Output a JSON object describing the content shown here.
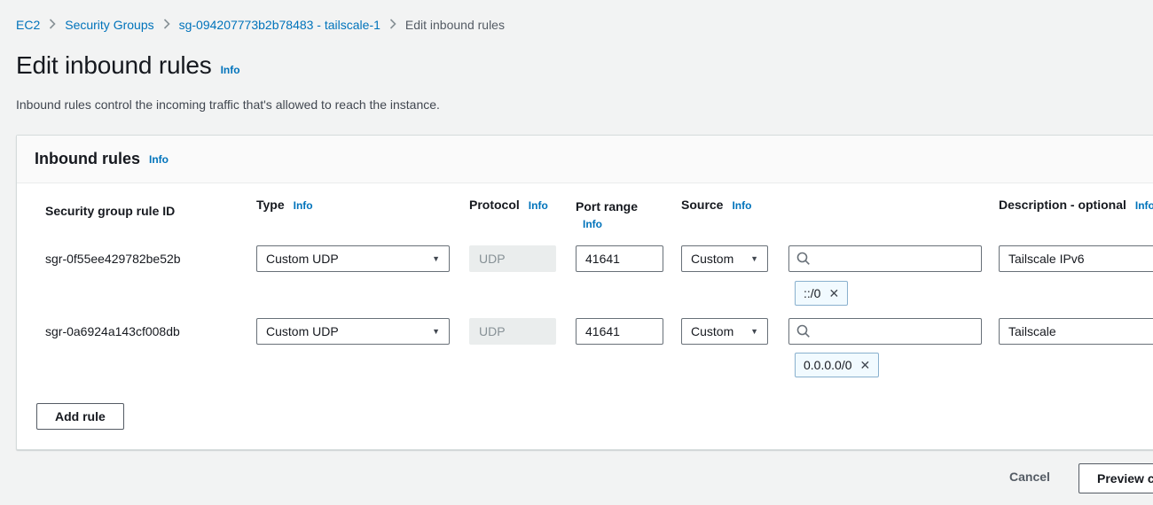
{
  "breadcrumb": {
    "items": [
      "EC2",
      "Security Groups",
      "sg-094207773b2b78483 - tailscale-1",
      "Edit inbound rules"
    ]
  },
  "header": {
    "title": "Edit inbound rules",
    "info": "Info",
    "subtitle": "Inbound rules control the incoming traffic that's allowed to reach the instance."
  },
  "panel": {
    "title": "Inbound rules",
    "info": "Info",
    "columns": {
      "rule_id": "Security group rule ID",
      "type": "Type",
      "protocol": "Protocol",
      "port_range": "Port range",
      "source": "Source",
      "description": "Description - optional",
      "info": "Info"
    },
    "rows": [
      {
        "rule_id": "sgr-0f55ee429782be52b",
        "type": "Custom UDP",
        "protocol": "UDP",
        "port_range": "41641",
        "source": "Custom",
        "source_token": "::/0",
        "description": "Tailscale IPv6"
      },
      {
        "rule_id": "sgr-0a6924a143cf008db",
        "type": "Custom UDP",
        "protocol": "UDP",
        "port_range": "41641",
        "source": "Custom",
        "source_token": "0.0.0.0/0",
        "description": "Tailscale"
      }
    ],
    "add_rule": "Add rule"
  },
  "footer": {
    "cancel": "Cancel",
    "preview": "Preview changes"
  },
  "colors": {
    "link": "#0073bb",
    "text": "#16191f",
    "secondary": "#545b64",
    "input_border": "#687078",
    "page_bg": "#f2f3f3",
    "token_bg": "#f1faff",
    "token_border": "#89b0ce"
  }
}
